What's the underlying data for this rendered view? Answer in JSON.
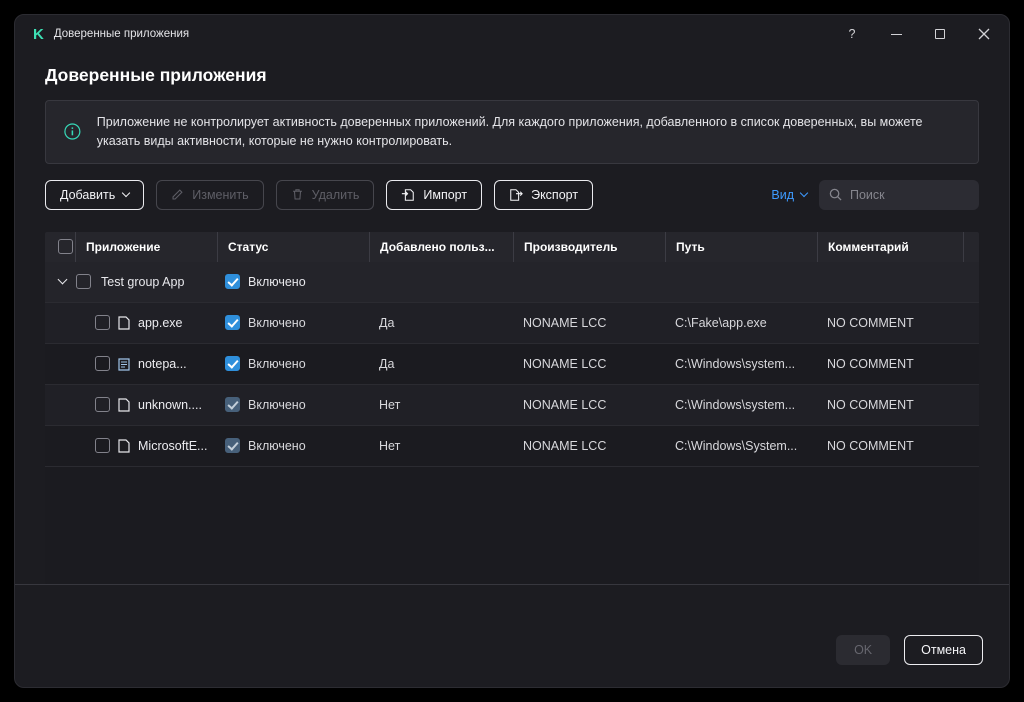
{
  "window": {
    "title": "Доверенные приложения"
  },
  "icons": {
    "logo": "K",
    "help": "?"
  },
  "page": {
    "title": "Доверенные приложения"
  },
  "banner": {
    "text": "Приложение не контролирует активность доверенных приложений. Для каждого приложения, добавленного в список доверенных, вы можете указать виды активности, которые не нужно контролировать."
  },
  "toolbar": {
    "add_label": "Добавить",
    "edit_label": "Изменить",
    "delete_label": "Удалить",
    "import_label": "Импорт",
    "export_label": "Экспорт",
    "view_label": "Вид",
    "search_placeholder": "Поиск"
  },
  "table": {
    "columns": {
      "application": "Приложение",
      "status": "Статус",
      "added_by_user": "Добавлено польз...",
      "vendor": "Производитель",
      "path": "Путь",
      "comment": "Комментарий"
    },
    "group": {
      "name": "Test group App",
      "status_label": "Включено"
    },
    "rows": [
      {
        "name": "app.exe",
        "status_label": "Включено",
        "added_by_user": "Да",
        "vendor": "NONAME LCC",
        "path": "C:\\Fake\\app.exe",
        "comment": "NO COMMENT"
      },
      {
        "name": "notepa...",
        "status_label": "Включено",
        "added_by_user": "Да",
        "vendor": "NONAME LCC",
        "path": "C:\\Windows\\system...",
        "comment": "NO COMMENT"
      },
      {
        "name": "unknown....",
        "status_label": "Включено",
        "added_by_user": "Нет",
        "vendor": "NONAME LCC",
        "path": "C:\\Windows\\system...",
        "comment": "NO COMMENT"
      },
      {
        "name": "MicrosoftE...",
        "status_label": "Включено",
        "added_by_user": "Нет",
        "vendor": "NONAME LCC",
        "path": "C:\\Windows\\System...",
        "comment": "NO COMMENT"
      }
    ]
  },
  "footer": {
    "ok_label": "OK",
    "cancel_label": "Отмена"
  },
  "colors": {
    "accent_green": "#3de0b4",
    "checkbox_blue": "#2f8fdb",
    "link_blue": "#3e9bff"
  }
}
